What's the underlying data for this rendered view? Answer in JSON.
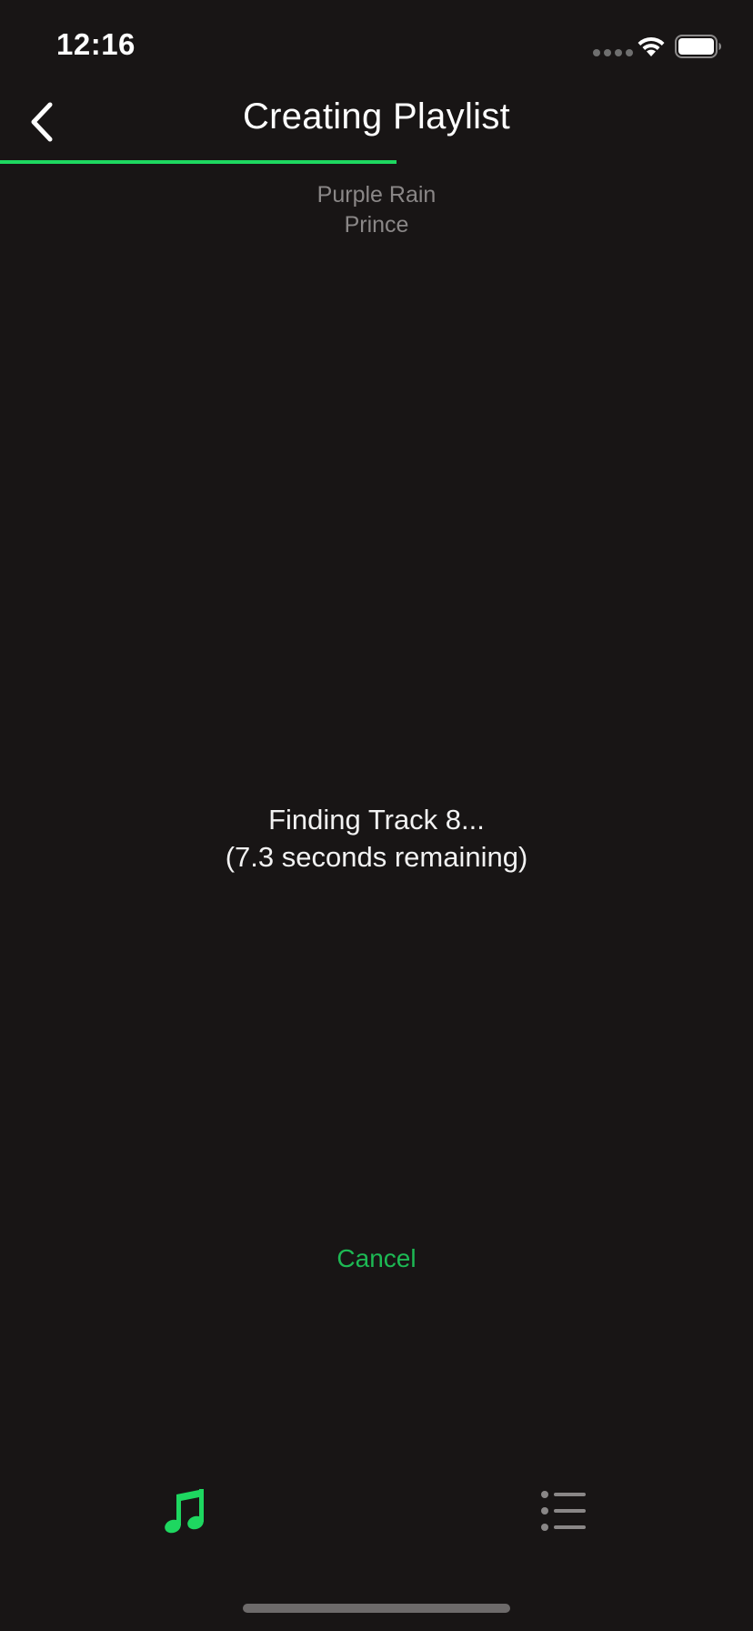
{
  "status_bar": {
    "time": "12:16",
    "signal_icon": "signal-dots-icon",
    "wifi_icon": "wifi-icon",
    "battery_icon": "battery-icon"
  },
  "nav": {
    "title": "Creating Playlist",
    "back_icon": "chevron-left-icon"
  },
  "progress": {
    "fraction": 0.527
  },
  "track": {
    "name": "Purple Rain",
    "artist": "Prince"
  },
  "status": {
    "line1": "Finding Track 8...",
    "line2": "(7.3 seconds remaining)"
  },
  "actions": {
    "cancel_label": "Cancel"
  },
  "tabs": [
    {
      "icon": "music-note-icon",
      "active": true
    },
    {
      "icon": "list-icon",
      "active": false
    }
  ],
  "colors": {
    "background": "#181515",
    "accent": "#1ed760",
    "secondary_text": "#8a8787"
  }
}
